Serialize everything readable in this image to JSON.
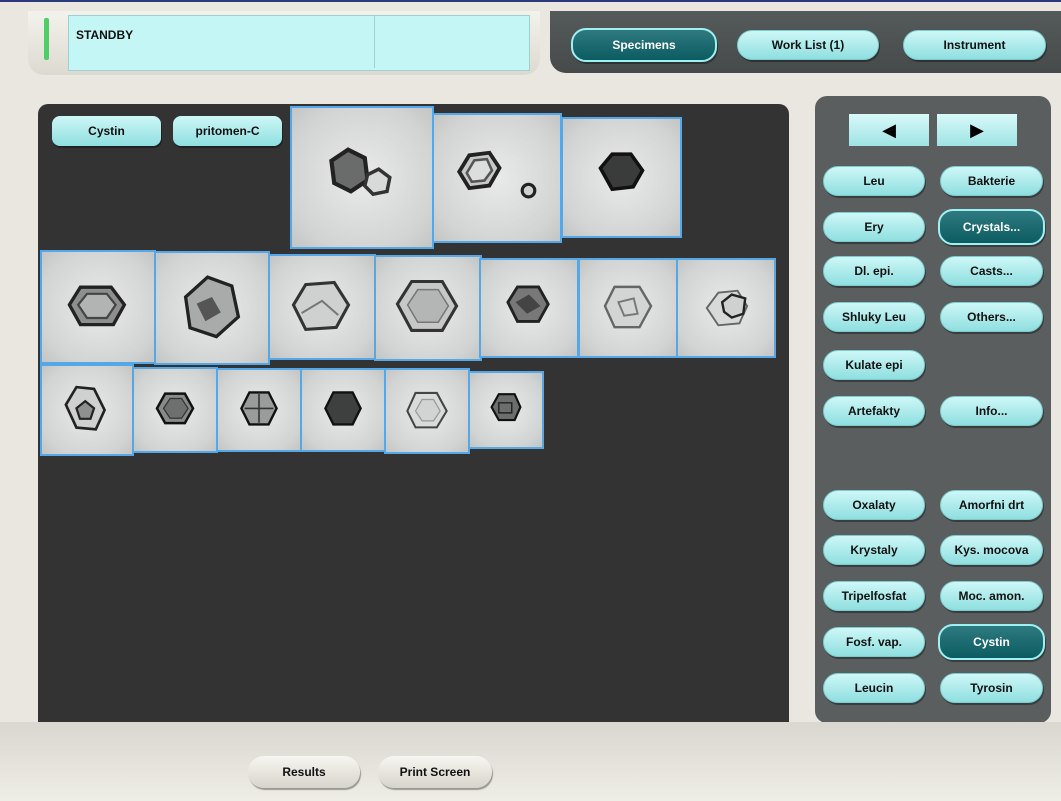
{
  "status": {
    "text": "STANDBY"
  },
  "nav": {
    "specimens": "Specimens",
    "worklist": "Work List (1)",
    "instrument": "Instrument"
  },
  "tags": {
    "first": "Cystin",
    "second": "pritomen-C"
  },
  "arrows": {
    "left": "◀",
    "right": "▶"
  },
  "categories": {
    "leu": "Leu",
    "bakterie": "Bakterie",
    "ery": "Ery",
    "crystals": "Crystals...",
    "dlepi": "Dl. epi.",
    "casts": "Casts...",
    "shluky": "Shluky Leu",
    "others": "Others...",
    "kulate": "Kulate epi",
    "artefakty": "Artefakty",
    "info": "Info..."
  },
  "subcategories": {
    "oxalaty": "Oxalaty",
    "amorfni": "Amorfni drt",
    "krystaly": "Krystaly",
    "kysmocova": "Kys. mocova",
    "tripelfosfat": "Tripelfosfat",
    "mocamon": "Moc. amon.",
    "fosfvap": "Fosf. vap.",
    "cystin": "Cystin",
    "leucin": "Leucin",
    "tyrosin": "Tyrosin"
  },
  "colors": {
    "accent_button": "#a7e8ea",
    "active_button": "#0b5c62",
    "panel_dark": "#333333",
    "thumb_border": "#55a8e8",
    "status_bg": "#c5f6f6"
  },
  "bottom": {
    "results": "Results",
    "print": "Print Screen"
  }
}
